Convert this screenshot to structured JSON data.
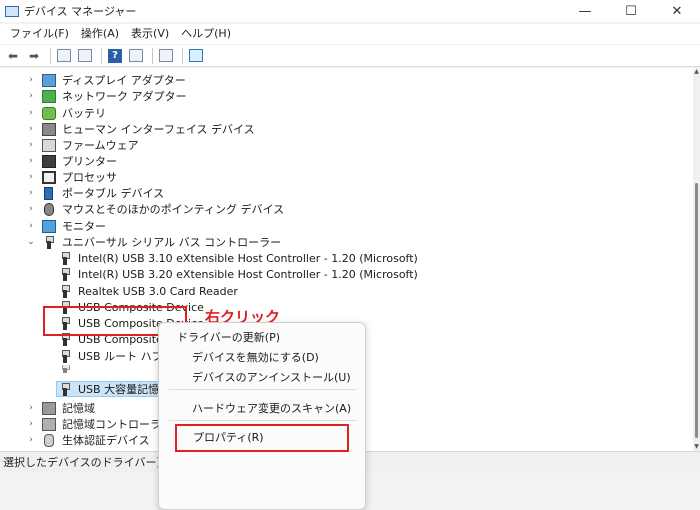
{
  "window": {
    "title": "デバイス マネージャー",
    "controls": {
      "minimize": "—",
      "maximize": "☐",
      "close": "✕"
    }
  },
  "menubar": [
    "ファイル(F)",
    "操作(A)",
    "表示(V)",
    "ヘルプ(H)"
  ],
  "tree": {
    "items": [
      {
        "label": "ディスプレイ アダプター",
        "expanded": false,
        "icon": "display-adapter-icon"
      },
      {
        "label": "ネットワーク アダプター",
        "expanded": false,
        "icon": "network-adapter-icon"
      },
      {
        "label": "バッテリ",
        "expanded": false,
        "icon": "battery-icon"
      },
      {
        "label": "ヒューマン インターフェイス デバイス",
        "expanded": false,
        "icon": "hid-icon"
      },
      {
        "label": "ファームウェア",
        "expanded": false,
        "icon": "firmware-icon"
      },
      {
        "label": "プリンター",
        "expanded": false,
        "icon": "printer-icon"
      },
      {
        "label": "プロセッサ",
        "expanded": false,
        "icon": "processor-icon"
      },
      {
        "label": "ポータブル デバイス",
        "expanded": false,
        "icon": "portable-device-icon"
      },
      {
        "label": "マウスとそのほかのポインティング デバイス",
        "expanded": false,
        "icon": "mouse-icon"
      },
      {
        "label": "モニター",
        "expanded": false,
        "icon": "monitor-icon"
      },
      {
        "label": "ユニバーサル シリアル バス コントローラー",
        "expanded": true,
        "icon": "usb-controller-icon"
      }
    ],
    "usb_children": [
      "Intel(R) USB 3.10 eXtensible Host Controller - 1.20 (Microsoft)",
      "Intel(R) USB 3.20 eXtensible Host Controller - 1.20 (Microsoft)",
      "Realtek USB 3.0 Card Reader",
      "USB Composite Device",
      "USB Composite Device",
      "USB Composite Device",
      "USB ルート ハブ (USB 3.0)",
      "USB 大容量記憶装置"
    ],
    "after_items": [
      {
        "label": "記憶域",
        "expanded": false,
        "icon": "storage-icon"
      },
      {
        "label": "記憶域コントローラー",
        "expanded": false,
        "icon": "storage-controller-icon"
      },
      {
        "label": "生体認証デバイス",
        "expanded": false,
        "icon": "biometric-icon"
      }
    ]
  },
  "annotation": "右クリック",
  "context_menu": [
    "ドライバーの更新(P)",
    "デバイスを無効にする(D)",
    "デバイスのアンインストール(U)",
    "ハードウェア変更のスキャン(A)",
    "プロパティ(R)"
  ],
  "statusbar": "選択したデバイスのドライバー更新ウィザードを起動します。",
  "colors": {
    "annotation_red": "#e02020",
    "selection": "#cce4f7"
  }
}
